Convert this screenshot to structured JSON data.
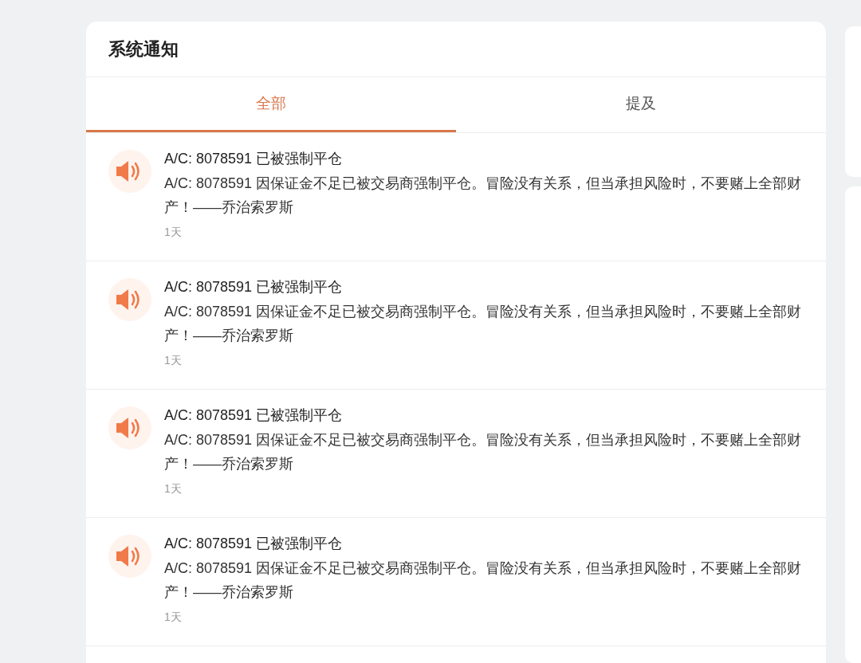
{
  "panel": {
    "title": "系统通知"
  },
  "tabs": [
    {
      "label": "全部",
      "selected": true
    },
    {
      "label": "提及",
      "selected": false
    }
  ],
  "notifications": [
    {
      "title": "A/C: 8078591 已被强制平仓",
      "body": "A/C: 8078591 因保证金不足已被交易商强制平仓。冒险没有关系，但当承担风险时，不要赌上全部财产！——乔治索罗斯",
      "time": "1天"
    },
    {
      "title": "A/C: 8078591 已被强制平仓",
      "body": "A/C: 8078591 因保证金不足已被交易商强制平仓。冒险没有关系，但当承担风险时，不要赌上全部财产！——乔治索罗斯",
      "time": "1天"
    },
    {
      "title": "A/C: 8078591 已被强制平仓",
      "body": "A/C: 8078591 因保证金不足已被交易商强制平仓。冒险没有关系，但当承担风险时，不要赌上全部财产！——乔治索罗斯",
      "time": "1天"
    },
    {
      "title": "A/C: 8078591 已被强制平仓",
      "body": "A/C: 8078591 因保证金不足已被交易商强制平仓。冒险没有关系，但当承担风险时，不要赌上全部财产！——乔治索罗斯",
      "time": "1天"
    }
  ]
}
